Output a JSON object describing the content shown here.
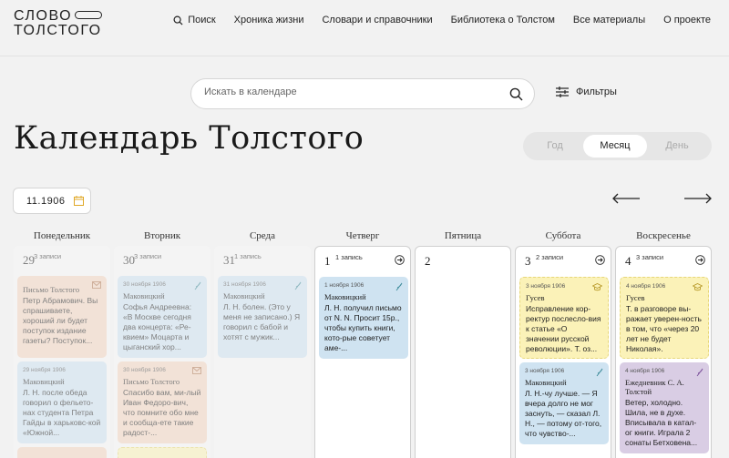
{
  "header": {
    "logo_line1": "СЛОВО",
    "logo_line2": "ТОЛСТОГО",
    "nav": [
      "Поиск",
      "Хроника жизни",
      "Словари и справочники",
      "Библиотека о Толстом",
      "Все материалы",
      "О проекте"
    ]
  },
  "search": {
    "placeholder": "Искать в календаре",
    "filters_label": "Фильтры"
  },
  "title": "Календарь Толстого",
  "view_switch": {
    "options": [
      "Год",
      "Месяц",
      "День"
    ],
    "active": "Месяц"
  },
  "date_value": "11.1906",
  "weekdays": [
    "Понедельник",
    "Вторник",
    "Среда",
    "Четверг",
    "Пятница",
    "Суббота",
    "Воскресенье"
  ],
  "days": [
    {
      "num": "29",
      "count": "3 записи",
      "cards": [
        {
          "color": "orange",
          "date": "",
          "author": "Письмо Толстого",
          "text": "Петр Абрамович. Вы спрашиваете, хороший ли будет поступок издание газеты? Поступок..."
        },
        {
          "color": "blue",
          "date": "29 ноября 1906",
          "author": "Маковицкий",
          "text": "Л. Н. после обеда говорил о фельето-нах студента Петра Гайды в харьковс-кой «Южной..."
        }
      ]
    },
    {
      "num": "30",
      "count": "3 записи",
      "cards": [
        {
          "color": "blue",
          "date": "30 ноября 1906",
          "author": "Маковицкий",
          "text": "Софья Андреевна: «В Москве сегодня два концерта: «Ре-квием» Моцарта и цыганский хор..."
        },
        {
          "color": "orange",
          "date": "30 ноября 1906",
          "author": "Письмо Толстого",
          "text": "Спасибо вам, ми-лый Иван Федоро-вич, что помните обо мне и сообща-ете такие радост-..."
        }
      ]
    },
    {
      "num": "31",
      "count": "1 запись",
      "cards": [
        {
          "color": "blue",
          "date": "31 ноября 1906",
          "author": "Маковицкий",
          "text": "Л. Н. болен. (Это у меня не записано.) Я говорил с бабой и хотят с мужик..."
        }
      ]
    },
    {
      "num": "1",
      "count": "1 запись",
      "cards": [
        {
          "color": "blue",
          "date": "1 ноября 1906",
          "author": "Маковицкий",
          "text": "Л. Н. получил письмо от N. N. Просит 15р., чтобы купить книги, кото-рые советует аме-..."
        }
      ]
    },
    {
      "num": "2",
      "count": "",
      "cards": []
    },
    {
      "num": "3",
      "count": "2 записи",
      "cards": [
        {
          "color": "yellow",
          "date": "3 ноября 1906",
          "author": "Гусев",
          "text": "Исправление кор-ректур послесло-вия к статье «О значении русской революции». Т. оз..."
        },
        {
          "color": "blue",
          "date": "3 ноября 1906",
          "author": "Маковицкий",
          "text": "Л. Н.-чу лучше. — Я вчера долго не мог заснуть, — сказал Л. Н., — потому от-того, что чувство-..."
        }
      ]
    },
    {
      "num": "4",
      "count": "3 записи",
      "cards": [
        {
          "color": "yellow",
          "date": "4 ноября 1906",
          "author": "Гусев",
          "text": "Т. в разговоре вы-ражает уверен-ность в том, что «через 20 лет не будет Николая»."
        },
        {
          "color": "purple",
          "date": "4 ноября 1906",
          "author": "Ежедневник С. А. Толстой",
          "text": "Ветер, холодно. Шила, не в духе. Вписывала в катал-ог книги. Играла 2 сонаты Бетховена..."
        }
      ]
    }
  ]
}
